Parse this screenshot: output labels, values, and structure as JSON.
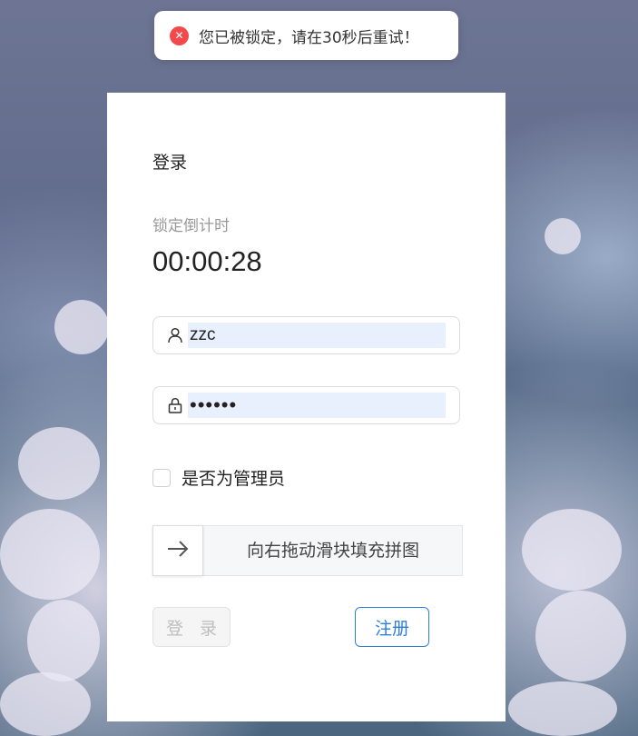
{
  "toast": {
    "icon": "error-circle-icon",
    "icon_glyph": "✕",
    "message": "您已被锁定，请在30秒后重试！",
    "color": "#f24a4a"
  },
  "login": {
    "title": "登录",
    "countdown_label": "锁定倒计时",
    "countdown_value": "00:00:28",
    "username_icon": "user-icon",
    "username_value": "zzc",
    "password_icon": "lock-icon",
    "password_value": "••••••",
    "admin_checkbox_label": "是否为管理员",
    "admin_checked": false,
    "slider_icon": "arrow-right-icon",
    "slider_text": "向右拖动滑块填充拼图",
    "login_button": "登 录",
    "register_button": "注册"
  },
  "colors": {
    "accent": "#2f7fd8",
    "autofill": "#e8f0fe"
  }
}
